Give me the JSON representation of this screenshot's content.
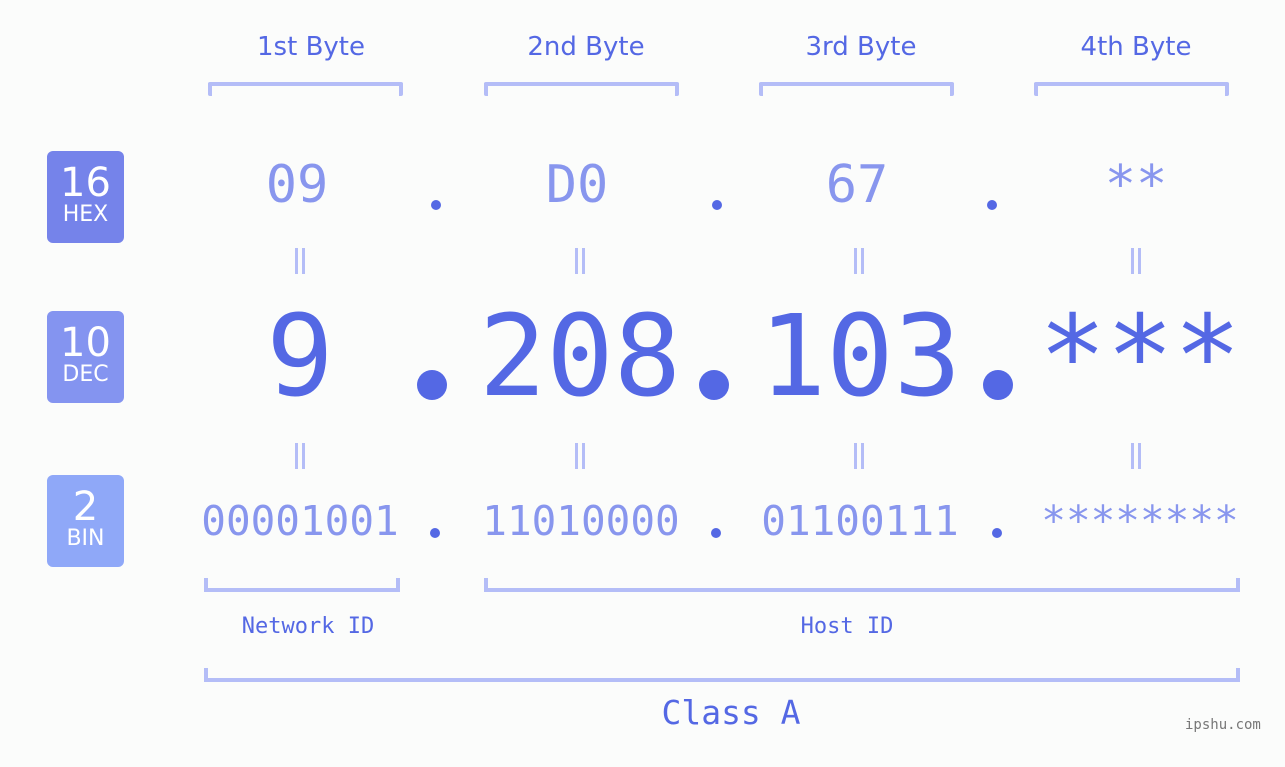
{
  "byte_headers": [
    "1st Byte",
    "2nd Byte",
    "3rd Byte",
    "4th Byte"
  ],
  "badges": {
    "hex": {
      "num": "16",
      "label": "HEX",
      "color": "#7583ea"
    },
    "dec": {
      "num": "10",
      "label": "DEC",
      "color": "#8494f0"
    },
    "bin": {
      "num": "2",
      "label": "BIN",
      "color": "#8fa8f8"
    }
  },
  "hex_values": [
    "09",
    "D0",
    "67",
    "**"
  ],
  "dec_values": [
    "9",
    "208",
    "103",
    "***"
  ],
  "bin_values": [
    "00001001",
    "11010000",
    "01100111",
    "********"
  ],
  "network_label": "Network ID",
  "host_label": "Host ID",
  "class_label": "Class A",
  "watermark": "ipshu.com",
  "colors": {
    "primary": "#5468e4",
    "light": "#8896ee",
    "bracket": "#b4bdf7",
    "background": "#fbfcfb"
  }
}
